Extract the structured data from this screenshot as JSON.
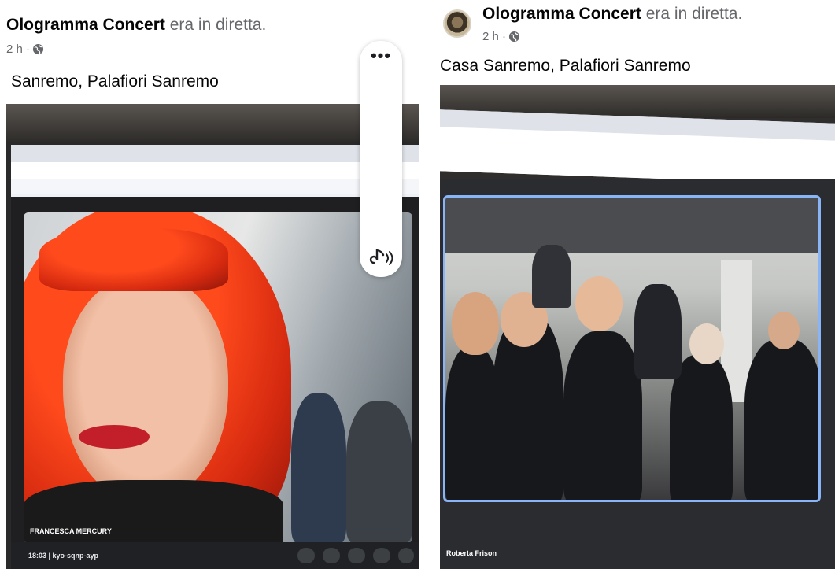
{
  "left_post": {
    "page_name": "Ologramma Concert",
    "status_text": "era in diretta.",
    "time": "2 h ·",
    "location": "Sanremo, Palafiori Sanremo",
    "video": {
      "participant_label": "FRANCESCA MERCURY",
      "meeting_info": "18:03 | kyo-sqnp-ayp"
    }
  },
  "right_post": {
    "page_name": "Ologramma Concert",
    "status_text": "era in diretta.",
    "time": "2 h ·",
    "location": "Casa Sanremo, Palafiori Sanremo",
    "video": {
      "participant_label": "Roberta Frison"
    }
  },
  "controls": {
    "more_label": "•••"
  },
  "colors": {
    "name_text": "#050505",
    "meta_text": "#65676b",
    "hair_red": "#e0301a",
    "call_frame_blue": "#8ab4f8"
  }
}
